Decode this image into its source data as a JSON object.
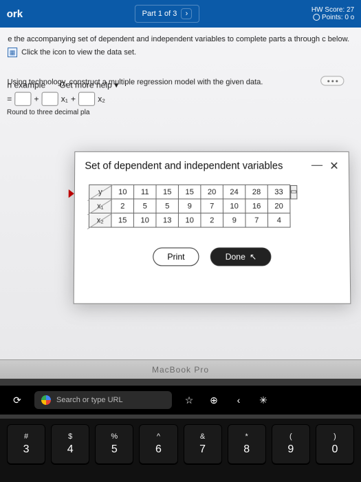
{
  "appbar": {
    "title_left": "ork",
    "part": "Part 1 of 3",
    "score_label": "HW Score: 27",
    "points_label": "Points: 0 o"
  },
  "instructions": {
    "line1": "e the accompanying set of dependent and independent variables to complete parts a through c below.",
    "line2": "Click the icon to view the data set."
  },
  "question": {
    "prompt": "Using technology, construct a multiple regression model with the given data.",
    "eq_prefix": "= ",
    "plus": "+",
    "x1": "x₁",
    "x2": "x₂",
    "round_note": "Round to three decimal pla"
  },
  "dialog": {
    "title": "Set of dependent and independent variables",
    "rows": [
      {
        "label": "y",
        "vals": [
          "10",
          "11",
          "15",
          "15",
          "20",
          "24",
          "28",
          "33"
        ]
      },
      {
        "label": "x₁",
        "vals": [
          "2",
          "5",
          "5",
          "9",
          "7",
          "10",
          "16",
          "20"
        ]
      },
      {
        "label": "x₂",
        "vals": [
          "15",
          "10",
          "13",
          "10",
          "2",
          "9",
          "7",
          "4"
        ]
      }
    ],
    "print": "Print",
    "done": "Done"
  },
  "help": {
    "example": "n example",
    "more": "Get more help"
  },
  "mac": {
    "label": "MacBook Pro"
  },
  "touchbar": {
    "search_placeholder": "Search or type URL"
  },
  "keys": [
    {
      "sym": "#",
      "num": "3"
    },
    {
      "sym": "$",
      "num": "4"
    },
    {
      "sym": "%",
      "num": "5"
    },
    {
      "sym": "^",
      "num": "6"
    },
    {
      "sym": "&",
      "num": "7"
    },
    {
      "sym": "*",
      "num": "8"
    },
    {
      "sym": "(",
      "num": "9"
    },
    {
      "sym": ")",
      "num": "0"
    }
  ]
}
